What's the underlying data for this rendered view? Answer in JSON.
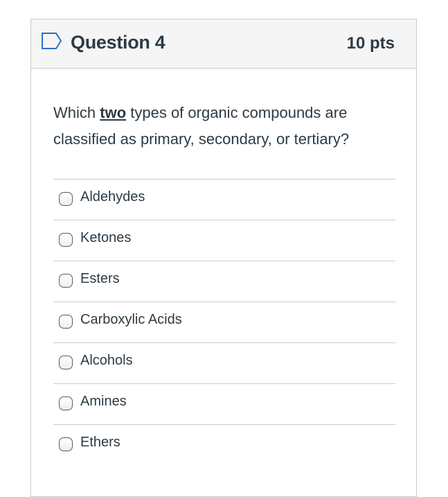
{
  "question": {
    "title": "Question 4",
    "points": "10 pts",
    "text_before": "Which ",
    "text_emphasis": "two",
    "text_after": " types of organic compounds are classified as primary, secondary, or tertiary?"
  },
  "answers": [
    {
      "label": "Aldehydes",
      "checked": false
    },
    {
      "label": "Ketones",
      "checked": false
    },
    {
      "label": "Esters",
      "checked": false
    },
    {
      "label": "Carboxylic Acids",
      "checked": false
    },
    {
      "label": "Alcohols",
      "checked": false
    },
    {
      "label": "Amines",
      "checked": false
    },
    {
      "label": "Ethers",
      "checked": false
    }
  ],
  "icons": {
    "flag": "flag-outline-icon"
  },
  "colors": {
    "text": "#2d3b45",
    "header_bg": "#f5f5f5",
    "border": "#c7cdd1",
    "flag": "#2d6ec9"
  }
}
